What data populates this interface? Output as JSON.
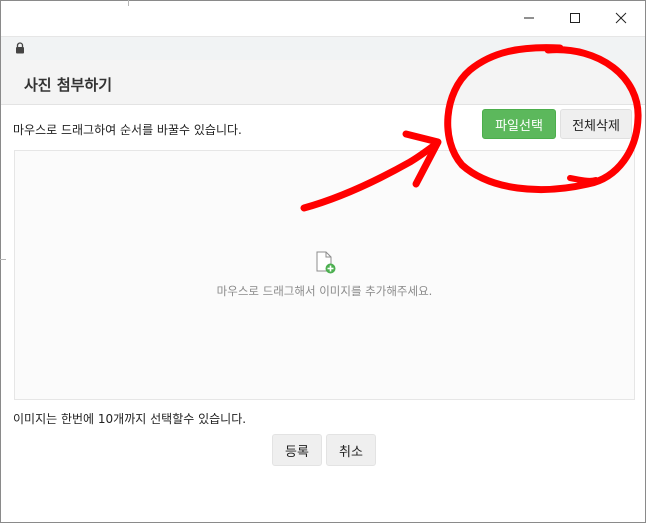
{
  "dialog": {
    "title": "사진 첨부하기",
    "instruction": "마우스로 드래그하여 순서를 바꿀수 있습니다.",
    "select_files_button": "파일선택",
    "delete_all_button": "전체삭제",
    "dropzone_text": "마우스로 드래그해서 이미지를 추가해주세요.",
    "limit_text": "이미지는 한번에 10개까지 선택할수 있습니다.",
    "register_button": "등록",
    "cancel_button": "취소"
  },
  "colors": {
    "primary_button": "#5cb85c",
    "annotation": "#ff0000",
    "dropzone_icon_badge": "#4caf50"
  },
  "icons": [
    "minimize-icon",
    "maximize-icon",
    "close-icon",
    "lock-icon",
    "add-file-icon"
  ]
}
